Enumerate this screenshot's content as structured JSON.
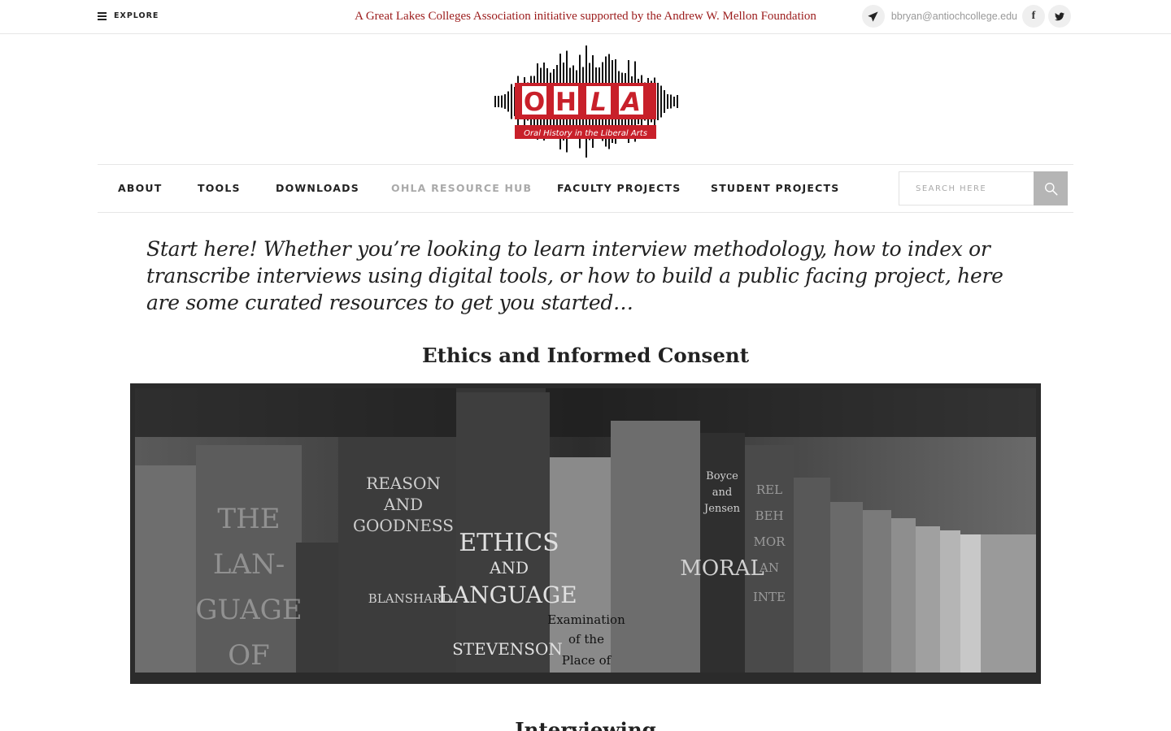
{
  "topbar": {
    "explore_label": "EXPLORE",
    "tagline": "A Great Lakes Colleges Association initiative supported by the Andrew W. Mellon Foundation",
    "email": "bbryan@antiochcollege.edu",
    "icons": [
      "menu-icon",
      "paper-plane-icon",
      "facebook-icon",
      "twitter-icon"
    ]
  },
  "logo": {
    "letters": [
      "O",
      "H",
      "L",
      "A"
    ],
    "subtitle": "Oral History in the Liberal Arts",
    "accent_color": "#c8202a"
  },
  "nav": {
    "items": [
      {
        "label": "ABOUT",
        "active": false
      },
      {
        "label": "TOOLS",
        "active": false
      },
      {
        "label": "DOWNLOADS",
        "active": false
      },
      {
        "label": "OHLA RESOURCE HUB",
        "active": true
      },
      {
        "label": "FACULTY PROJECTS",
        "active": false
      },
      {
        "label": "STUDENT PROJECTS",
        "active": false
      }
    ],
    "search_placeholder": "SEARCH HERE"
  },
  "main": {
    "intro": "Start here! Whether you’re looking to learn interview methodology, how to index or transcribe interviews using digital tools, or how to build a public facing project, here are some curated resources to get you started…",
    "section_title": "Ethics and Informed Consent",
    "next_section_title": "Interviewing",
    "book_spines": [
      {
        "lines": [
          "THE",
          "LAN-",
          "GUAGE",
          "OF"
        ]
      },
      {
        "lines": [
          "REASON",
          "AND",
          "GOODNESS",
          "BLANSHARD"
        ]
      },
      {
        "lines": [
          "ETHICS",
          "AND",
          "LANGUAGE",
          "STEVENSON"
        ]
      },
      {
        "lines": [
          "Examination",
          "of the",
          "Place of"
        ]
      },
      {
        "lines": [
          "Boyce",
          "and",
          "Jensen",
          "MORAL"
        ]
      },
      {
        "lines": [
          "REL",
          "BEH",
          "MOR",
          "AN",
          "INTE"
        ]
      }
    ]
  },
  "colors": {
    "tagline": "#9b1b1b",
    "nav_active": "#aaaaaa",
    "search_button": "#b5b5b5"
  }
}
